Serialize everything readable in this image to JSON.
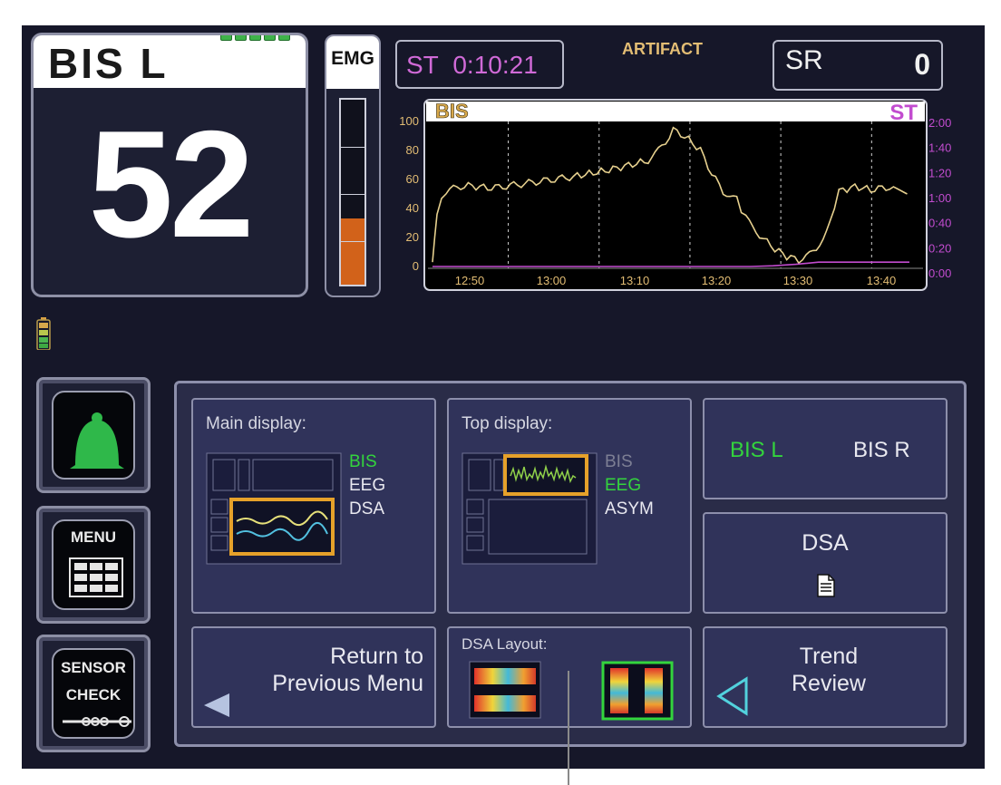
{
  "bis_panel": {
    "title": "BIS L",
    "value": "52",
    "signal_bars": 5
  },
  "emg": {
    "label": "EMG",
    "level_fraction": 0.36
  },
  "status": {
    "st_label": "ST",
    "st_time": "0:10:21",
    "artifact": "ARTIFACT",
    "sr_label": "SR",
    "sr_value": "0"
  },
  "chart_data": {
    "type": "line",
    "title": "BIS",
    "right_title": "ST",
    "x": [
      "12:50",
      "13:00",
      "13:10",
      "13:20",
      "13:30",
      "13:40"
    ],
    "y_left_ticks": [
      "100",
      "80",
      "60",
      "40",
      "20",
      "0"
    ],
    "y_right_ticks": [
      "2:00",
      "1:40",
      "1:20",
      "1:00",
      "0:40",
      "0:20",
      "0:00"
    ],
    "ylim": [
      0,
      100
    ],
    "series": [
      {
        "name": "BIS",
        "color": "#e6d08e",
        "points": [
          [
            12.0,
            3
          ],
          [
            12.2,
            38
          ],
          [
            12.6,
            52
          ],
          [
            13.4,
            56
          ],
          [
            14.6,
            54
          ],
          [
            16.4,
            58
          ],
          [
            18.2,
            62
          ],
          [
            19.6,
            66
          ],
          [
            21.5,
            73
          ],
          [
            22.1,
            82
          ],
          [
            22.6,
            94
          ],
          [
            23.1,
            90
          ],
          [
            23.8,
            80
          ],
          [
            24.3,
            64
          ],
          [
            24.8,
            52
          ],
          [
            25.4,
            46
          ],
          [
            25.8,
            33
          ],
          [
            26.4,
            22
          ],
          [
            26.9,
            14
          ],
          [
            27.6,
            7
          ],
          [
            28.3,
            4
          ],
          [
            28.9,
            12
          ],
          [
            29.5,
            30
          ],
          [
            29.9,
            52
          ],
          [
            30.6,
            55
          ],
          [
            31.3,
            53
          ],
          [
            32.3,
            55
          ],
          [
            32.9,
            50
          ]
        ]
      },
      {
        "name": "ST",
        "color": "#c24ccf",
        "points": [
          [
            12.0,
            0
          ],
          [
            26.0,
            0
          ],
          [
            27.0,
            0.5
          ],
          [
            28.0,
            1.5
          ],
          [
            29.0,
            3
          ],
          [
            33.0,
            3
          ]
        ]
      }
    ]
  },
  "colors": {
    "green": "#33d43d",
    "accent_orange": "#e6a12a",
    "cyan": "#52d2dd"
  },
  "side_buttons": {
    "alarm_icon": "bell-icon",
    "menu_label": "MENU",
    "sensor_line1": "SENSOR",
    "sensor_line2": "CHECK"
  },
  "menu": {
    "main_display": {
      "title": "Main display:",
      "options": [
        "BIS",
        "EEG",
        "DSA"
      ],
      "selected": "BIS"
    },
    "top_display": {
      "title": "Top display:",
      "options": [
        "BIS",
        "EEG",
        "ASYM"
      ],
      "selected": "EEG",
      "disabled": "BIS"
    },
    "bis_side": {
      "left": "BIS L",
      "right": "BIS R",
      "selected": "BIS L"
    },
    "dsa": {
      "label": "DSA",
      "icon": "document-icon"
    },
    "return_line1": "Return to",
    "return_line2": "Previous Menu",
    "dsa_layout_title": "DSA Layout:",
    "trend_line1": "Trend",
    "trend_line2": "Review"
  }
}
